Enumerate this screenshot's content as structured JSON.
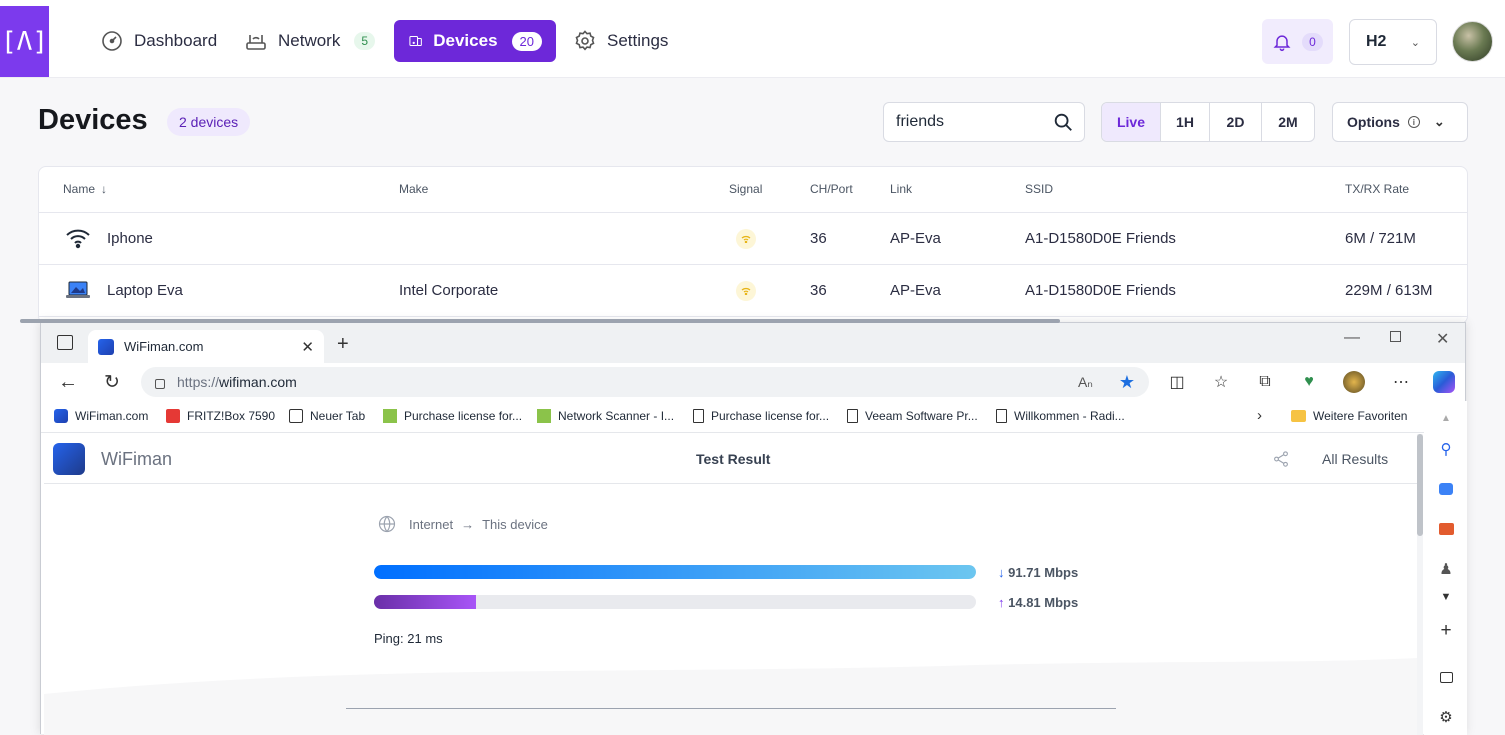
{
  "app": {
    "logo_text": "[^]",
    "nav": {
      "dashboard": "Dashboard",
      "network": "Network",
      "network_count": "5",
      "devices": "Devices",
      "devices_count": "20",
      "settings": "Settings"
    },
    "notifications_count": "0",
    "site": "H2",
    "accent": "#6d28d9"
  },
  "page": {
    "title": "Devices",
    "count_badge": "2 devices",
    "search_value": "friends",
    "ranges": [
      "Live",
      "1H",
      "2D",
      "2M"
    ],
    "options_label": "Options"
  },
  "table": {
    "columns": [
      "Name",
      "Make",
      "Signal",
      "CH/Port",
      "Link",
      "SSID",
      "TX/RX Rate"
    ],
    "rows": [
      {
        "icon": "wifi-icon",
        "name": "Iphone",
        "make": "",
        "ch": "36",
        "link": "AP-Eva",
        "ssid": "A1-D1580D0E Friends",
        "rate": "6M / 721M"
      },
      {
        "icon": "laptop-icon",
        "name": "Laptop Eva",
        "make": "Intel Corporate",
        "ch": "36",
        "link": "AP-Eva",
        "ssid": "A1-D1580D0E Friends",
        "rate": "229M / 613M"
      }
    ]
  },
  "browser": {
    "tab_title": "WiFiman.com",
    "url_scheme": "https://",
    "url_host": "wifiman.com",
    "favorites": [
      "WiFiman.com",
      "FRITZ!Box 7590",
      "Neuer Tab",
      "Purchase license for...",
      "Network Scanner - I...",
      "Purchase license for...",
      "Veeam Software Pr...",
      "Willkommen - Radi..."
    ],
    "more_favorites": "Weitere Favoriten"
  },
  "wifiman": {
    "brand": "WiFiman",
    "title": "Test Result",
    "all_results": "All Results",
    "route_from": "Internet",
    "route_to": "This device",
    "download": "91.71 Mbps",
    "upload": "14.81 Mbps",
    "download_fraction": 1.0,
    "upload_fraction": 0.17,
    "ping": "Ping: 21 ms"
  }
}
